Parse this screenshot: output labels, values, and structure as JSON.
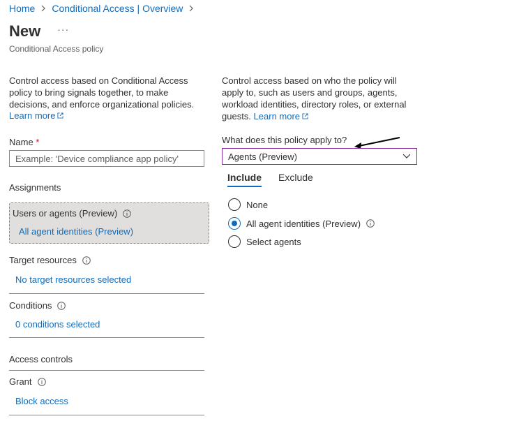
{
  "breadcrumb": {
    "items": [
      "Home",
      "Conditional Access | Overview"
    ]
  },
  "header": {
    "title": "New",
    "more": "···",
    "subtitle": "Conditional Access policy"
  },
  "left": {
    "description": "Control access based on Conditional Access policy to bring signals together, to make decisions, and enforce organizational policies.",
    "learn_more": "Learn more",
    "name_label": "Name",
    "required_mark": "*",
    "name_placeholder": "Example: 'Device compliance app policy'",
    "assignments_heading": "Assignments",
    "users_title": "Users or agents (Preview)",
    "users_value": "All agent identities (Preview)",
    "target_title": "Target resources",
    "target_value": "No target resources selected",
    "conditions_title": "Conditions",
    "conditions_value": "0 conditions selected",
    "access_heading": "Access controls",
    "grant_title": "Grant",
    "grant_value": "Block access"
  },
  "right": {
    "description": "Control access based on who the policy will apply to, such as users and groups, agents, workload identities, directory roles, or external guests.",
    "learn_more": "Learn more",
    "apply_label": "What does this policy apply to?",
    "dropdown_value": "Agents (Preview)",
    "tabs": [
      "Include",
      "Exclude"
    ],
    "radio_options": [
      "None",
      "All agent identities (Preview)",
      "Select agents"
    ],
    "selected_option": "All agent identities (Preview)"
  },
  "colors": {
    "link": "#0f6cbd",
    "dropdown_border": "#8a2ca0",
    "required": "#c50f1f"
  },
  "icons": [
    "chevron-right-icon",
    "external-link-icon",
    "info-icon",
    "chevron-down-icon",
    "arrow-annotation"
  ]
}
